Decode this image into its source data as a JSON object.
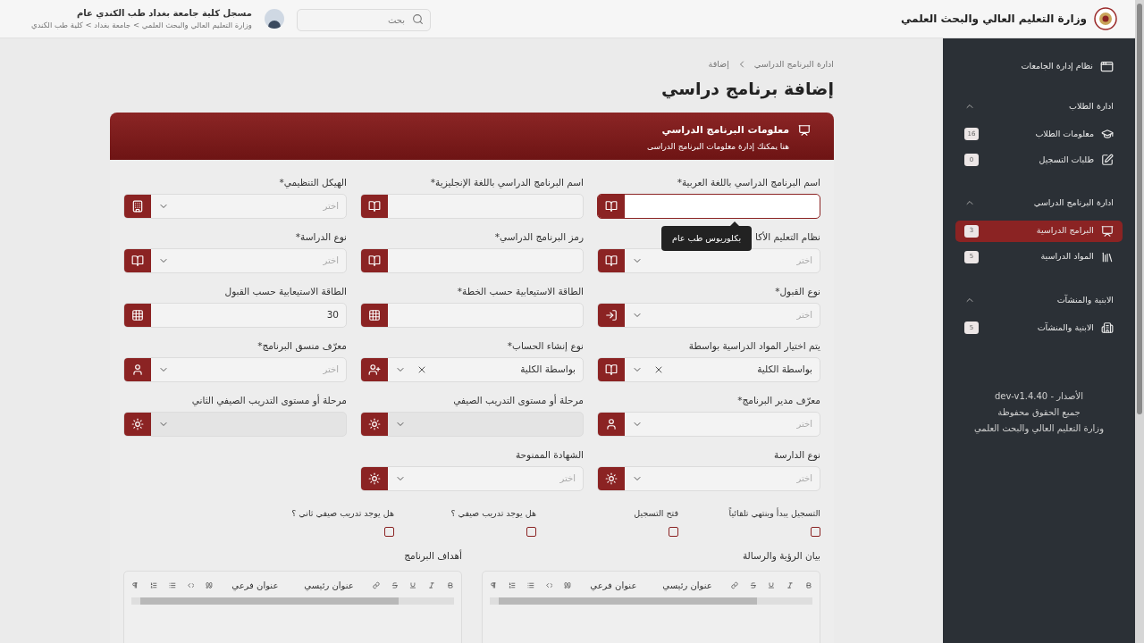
{
  "header": {
    "ministry": "وزارة التعليم العالي والبحث العلمي",
    "search": {
      "placeholder": "بحث"
    },
    "user": {
      "name": "مسجل كلية جامعة بغداد طب الكندي عام",
      "path": "وزارة التعليم العالي والبحث العلمي > جامعة بغداد > كلية طب الكندي"
    }
  },
  "sidebar": {
    "title": "نظام إدارة الجامعات",
    "groups": [
      {
        "title": "ادارة الطلاب",
        "expanded": true,
        "items": [
          {
            "label": "معلومات الطلاب",
            "count": "16",
            "kind": "students",
            "selected": false
          },
          {
            "label": "طلبات التسجيل",
            "count": "0",
            "kind": "requests",
            "selected": false
          }
        ]
      },
      {
        "title": "ادارة البرنامج الدراسي",
        "expanded": true,
        "items": [
          {
            "label": "البرامج الدراسية",
            "count": "3",
            "kind": "programs",
            "selected": true
          },
          {
            "label": "المواد الدراسية",
            "count": "5",
            "kind": "subjects",
            "selected": false
          }
        ]
      },
      {
        "title": "الابنية والمنشآت",
        "expanded": true,
        "items": [
          {
            "label": "الابنية والمنشآت",
            "count": "5",
            "kind": "buildings",
            "selected": false
          }
        ]
      }
    ],
    "footer": [
      "الأصدار - dev-v1.4.40",
      "جميع الحقوق محفوظة",
      "وزارة التعليم العالي والبحث العلمي"
    ]
  },
  "page": {
    "breadcrumb": [
      "ادارة البرنامج الدراسي",
      "إضافة"
    ],
    "title": "إضافة برنامج دراسي"
  },
  "form": {
    "title": "معلومات البرنامج الدراسي",
    "subtitle": "هنا يمكنك إدارة معلومات البرنامج الدراسى",
    "fields": [
      {
        "label": "اسم البرنامج الدراسي باللغة العربية*",
        "kind": "text",
        "adornment": {
          "kind": "book"
        },
        "focused": true,
        "disabled": false
      },
      {
        "label": "اسم البرنامج الدراسي باللغة الإنجليزية*",
        "kind": "text",
        "adornment": {
          "kind": "book"
        },
        "focused": false,
        "disabled": false
      },
      {
        "label": "الهيكل التنظيمي*",
        "kind": "select",
        "adornment": {
          "kind": "building"
        },
        "placeholder": "اختر",
        "focused": false,
        "disabled": false
      },
      {
        "label": "نظام التعليم الأكا",
        "kind": "select",
        "adornment": {
          "kind": "book"
        },
        "placeholder": "اختر",
        "focused": false,
        "disabled": false
      },
      {
        "label": "رمز البرنامج الدراسي*",
        "kind": "text",
        "adornment": {
          "kind": "book"
        },
        "focused": false,
        "disabled": false
      },
      {
        "label": "نوع الدراسة*",
        "kind": "select",
        "adornment": {
          "kind": "book"
        },
        "placeholder": "اختر",
        "focused": false,
        "disabled": false
      },
      {
        "label": "نوع القبول*",
        "kind": "select",
        "adornment": {
          "kind": "login"
        },
        "placeholder": "اختر",
        "focused": false,
        "disabled": false
      },
      {
        "label": "الطاقة الاستيعابية حسب الخطة*",
        "kind": "text",
        "adornment": {
          "kind": "grid"
        },
        "focused": false,
        "disabled": false
      },
      {
        "label": "الطاقة الاستيعابية حسب القبول",
        "kind": "text",
        "adornment": {
          "kind": "grid"
        },
        "value": "30",
        "focused": false,
        "disabled": false
      },
      {
        "label": "يتم اختيار المواد الدراسية بواسطة",
        "kind": "select",
        "adornment": {
          "kind": "book"
        },
        "value": "بواسطة الكلية",
        "clearable": true,
        "focused": false,
        "disabled": false
      },
      {
        "label": "نوع إنشاء الحساب*",
        "kind": "select",
        "adornment": {
          "kind": "user-plus"
        },
        "value": "بواسطة الكلية",
        "clearable": true,
        "focused": false,
        "disabled": false
      },
      {
        "label": "معرّف منسق البرنامج*",
        "kind": "select",
        "adornment": {
          "kind": "user"
        },
        "placeholder": "اختر",
        "focused": false,
        "disabled": false
      },
      {
        "label": "معرّف مدير البرنامج*",
        "kind": "select",
        "adornment": {
          "kind": "user"
        },
        "placeholder": "اختر",
        "focused": false,
        "disabled": false
      },
      {
        "label": "مرحلة أو مستوى التدريب الصيفي",
        "kind": "select",
        "adornment": {
          "kind": "sun"
        },
        "focused": false,
        "disabled": true
      },
      {
        "label": "مرحلة أو مستوى التدريب الصيفي الثاني",
        "kind": "select",
        "adornment": {
          "kind": "sun"
        },
        "focused": false,
        "disabled": true
      },
      {
        "label": "نوع الدارسة",
        "kind": "select",
        "adornment": {
          "kind": "sun"
        },
        "placeholder": "اختر",
        "focused": false,
        "disabled": false
      },
      {
        "label": "الشهادة الممنوحة",
        "kind": "select",
        "adornment": {
          "kind": "sun"
        },
        "placeholder": "اختر",
        "focused": false,
        "disabled": false
      }
    ],
    "tooltip": "بكلوريوس طب عام",
    "checkboxes": [
      {
        "label": "التسجيل يبدأ وينتهي تلقائياً",
        "checked": false
      },
      {
        "label": "فتح التسجيل",
        "checked": false
      },
      {
        "label": "هل يوجد تدريب صيفي ؟",
        "checked": false
      },
      {
        "label": "هل يوجد تدريب صيفي ثاني ؟",
        "checked": false
      }
    ],
    "editors": [
      {
        "label": "بيان الرؤية والرسالة",
        "headings": [
          "عنوان رئيسي",
          "عنوان فرعي"
        ]
      },
      {
        "label": "أهداف البرنامج",
        "headings": [
          "عنوان رئيسي",
          "عنوان فرعي"
        ]
      }
    ]
  }
}
